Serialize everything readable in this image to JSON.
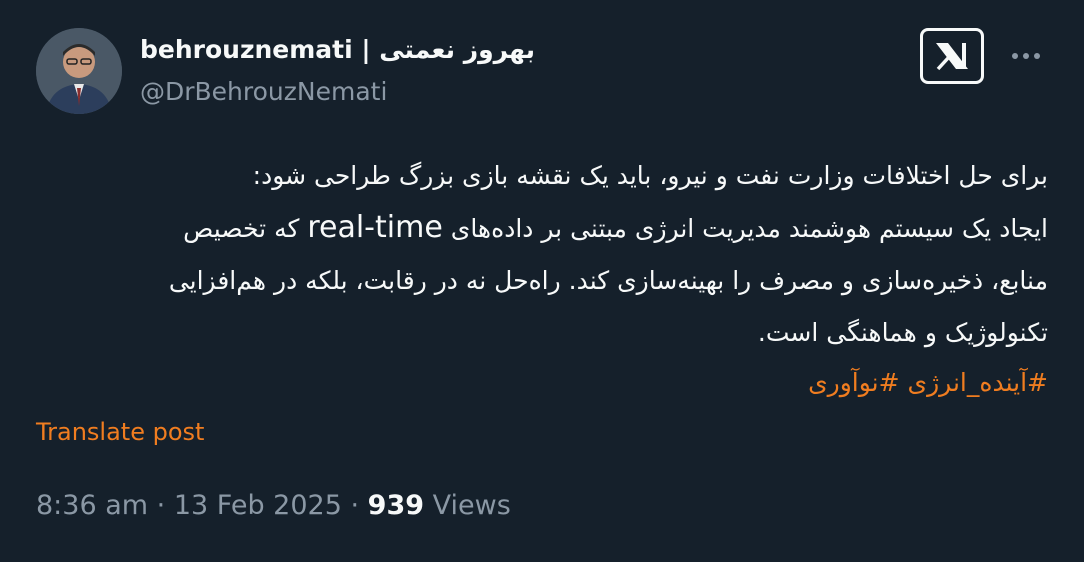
{
  "author": {
    "display_name": "behrouznemati | بهروز نعمتی",
    "handle": "@DrBehrouzNemati"
  },
  "icons": {
    "avatar": "profile-photo",
    "logo": "x-logo-icon",
    "more": "more-options-icon"
  },
  "body": {
    "line1": "برای حل اختلافات وزارت نفت و نیرو، باید یک نقشه بازی بزرگ طراحی شود:",
    "line2_before": "ایجاد یک سیستم هوشمند مدیریت انرژی مبتنی بر داده‌های",
    "line2_latin": "real-time",
    "line2_after": "که تخصیص",
    "line3": "منابع، ذخیره‌سازی و مصرف را بهینه‌سازی کند. راه‌حل نه در رقابت، بلکه در هم‌افزایی",
    "line4": "تکنولوژیک و هماهنگی است."
  },
  "hashtags": [
    "#آینده_انرژی",
    "#نوآوری"
  ],
  "translate_label": "Translate post",
  "meta": {
    "time": "8:36 am",
    "separator": "·",
    "date": "13 Feb 2025",
    "views_count": "939",
    "views_label": "Views"
  },
  "colors": {
    "background": "#15202b",
    "text": "#f7f9f9",
    "secondary": "#8b98a5",
    "accent": "#f07d20"
  }
}
